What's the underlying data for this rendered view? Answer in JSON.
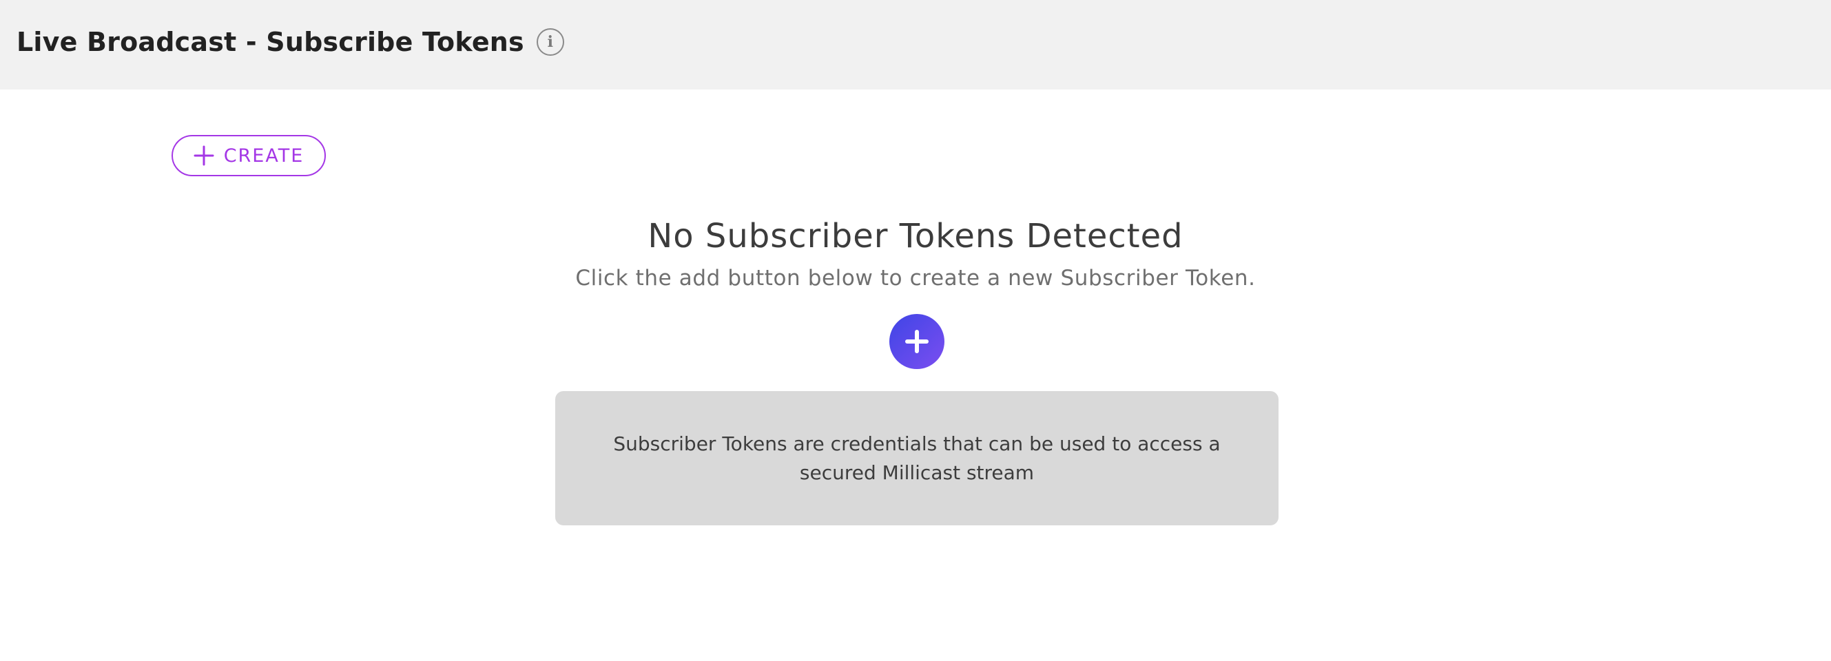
{
  "header": {
    "title": "Live Broadcast - Subscribe Tokens",
    "info_icon": "info-icon"
  },
  "toolbar": {
    "create_label": "CREATE",
    "create_icon": "plus-icon"
  },
  "empty_state": {
    "title": "No Subscriber Tokens Detected",
    "subtitle": "Click the add button below to create a new Subscriber Token.",
    "add_icon": "plus-icon",
    "info_text": "Subscriber Tokens are credentials that can be used to access a secured Millicast stream"
  },
  "colors": {
    "accent": "#a437e6",
    "fab_gradient_start": "#3f45e6",
    "fab_gradient_end": "#7b4ef0",
    "header_bg": "#f1f1f1",
    "panel_bg": "#d9d9d9"
  }
}
